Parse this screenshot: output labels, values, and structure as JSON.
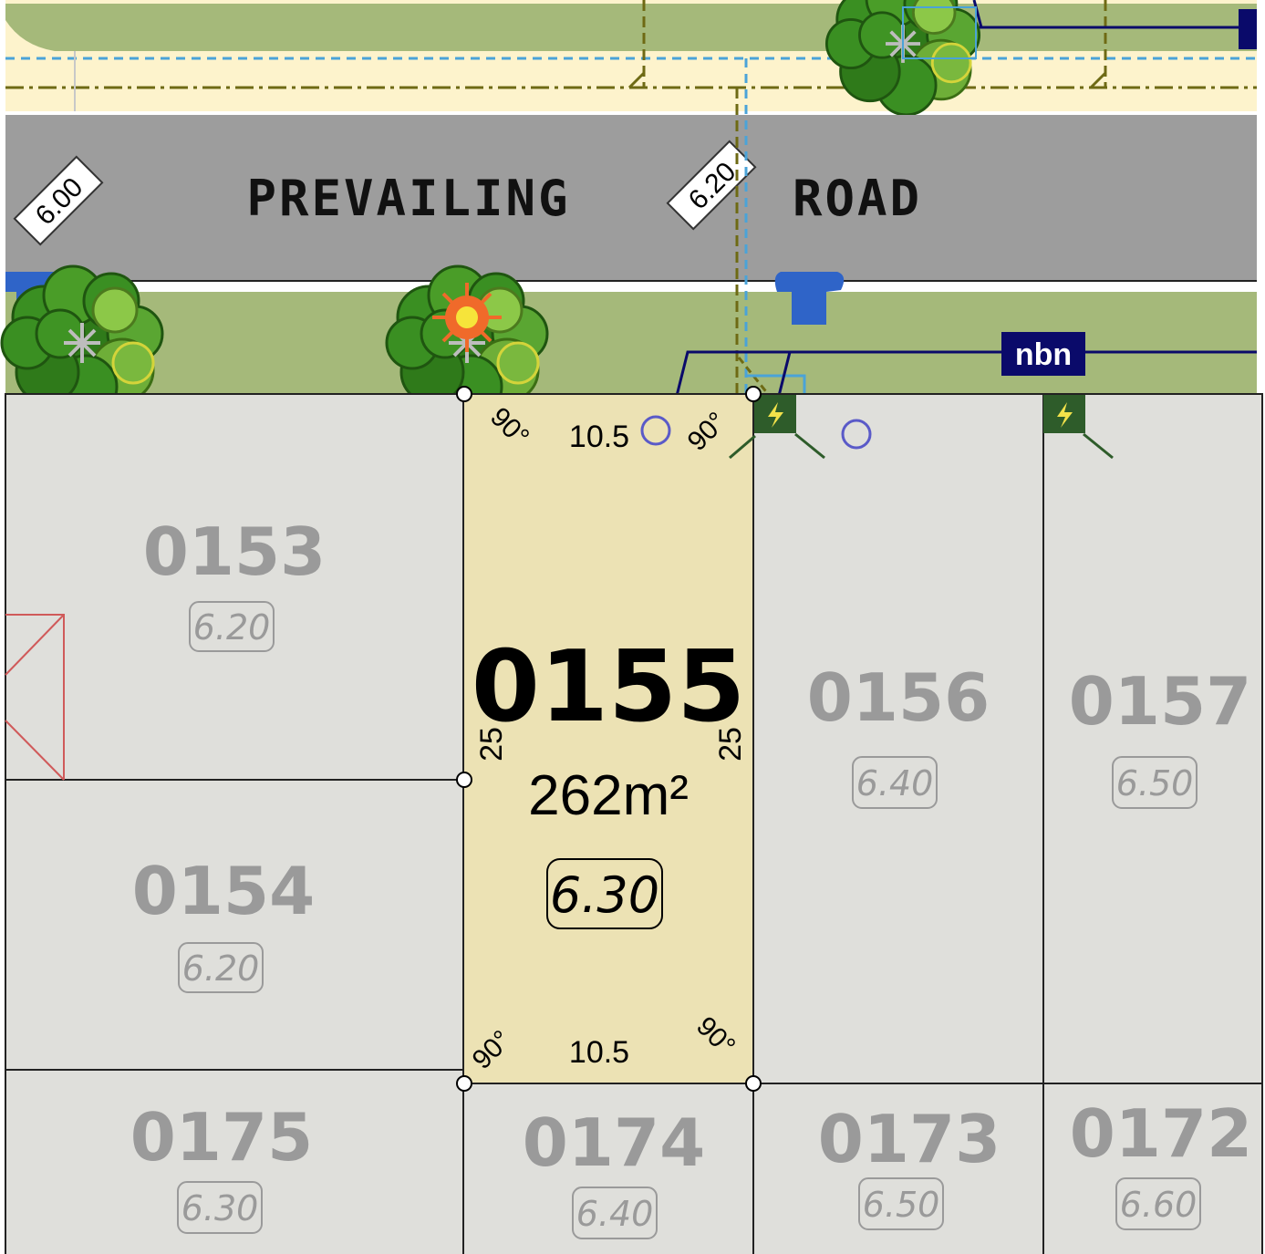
{
  "road": {
    "name_left": "PREVAILING",
    "name_right": "ROAD"
  },
  "kerb_labels": [
    "6.00",
    "6.20"
  ],
  "lots": [
    {
      "id": "0153",
      "level": "6.20"
    },
    {
      "id": "0154",
      "level": "6.20"
    },
    {
      "id": "0155",
      "level": "6.30",
      "area": "262m²",
      "highlight": true
    },
    {
      "id": "0156",
      "level": "6.40"
    },
    {
      "id": "0157",
      "level": "6.50"
    },
    {
      "id": "0175",
      "level": "6.30"
    },
    {
      "id": "0174",
      "level": "6.40"
    },
    {
      "id": "0173",
      "level": "6.50"
    },
    {
      "id": "0172",
      "level": "6.60"
    }
  ],
  "dimensions": {
    "top": "10.5",
    "bottom": "10.5",
    "left": "25",
    "right": "25",
    "angle": "90°"
  },
  "utilities": {
    "nbn_label": "nbn"
  },
  "colors": {
    "road": "#9d9d9d",
    "verge": "#a5b97a",
    "footpath": "#fdf3cc",
    "lot": "#dfdfdb",
    "lot_highlight": "#ece2b4",
    "nbn_box": "#0a0a6a",
    "power_pit": "#2e5c2a",
    "water_meter": "#2f64c8"
  }
}
